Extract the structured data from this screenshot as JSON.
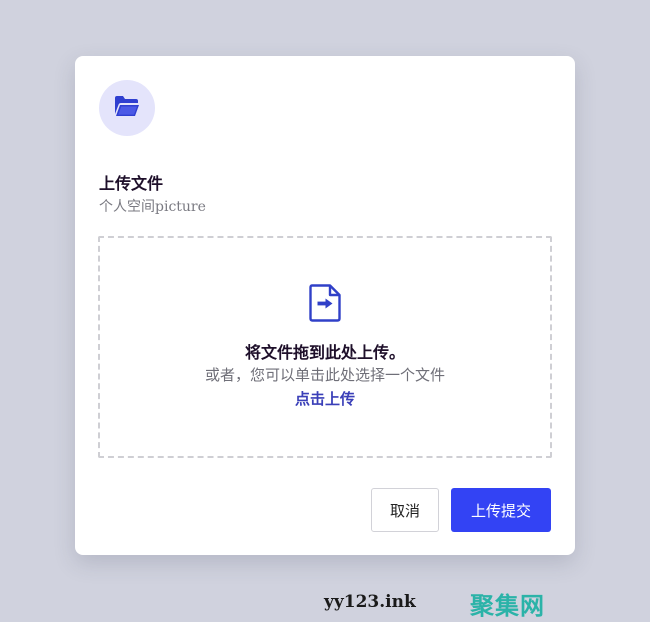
{
  "dialog": {
    "icon": "folder-open-icon",
    "title": "上传文件",
    "subtitle": "个人空间picture"
  },
  "dropzone": {
    "icon": "file-upload-icon",
    "main_text": "将文件拖到此处上传。",
    "alt_text": "或者，您可以单击此处选择一个文件",
    "link_text": "点击上传"
  },
  "actions": {
    "cancel_label": "取消",
    "submit_label": "上传提交"
  },
  "watermark": {
    "left_text": "yy123.ink",
    "right_text": "聚集网"
  },
  "colors": {
    "page_background": "#d0d2de",
    "accent": "#3343f4",
    "icon_blue": "#2f3fd0",
    "icon_badge": "#e4e4fb",
    "link": "#3a3fb8",
    "watermark_teal": "#2bb3a8"
  }
}
